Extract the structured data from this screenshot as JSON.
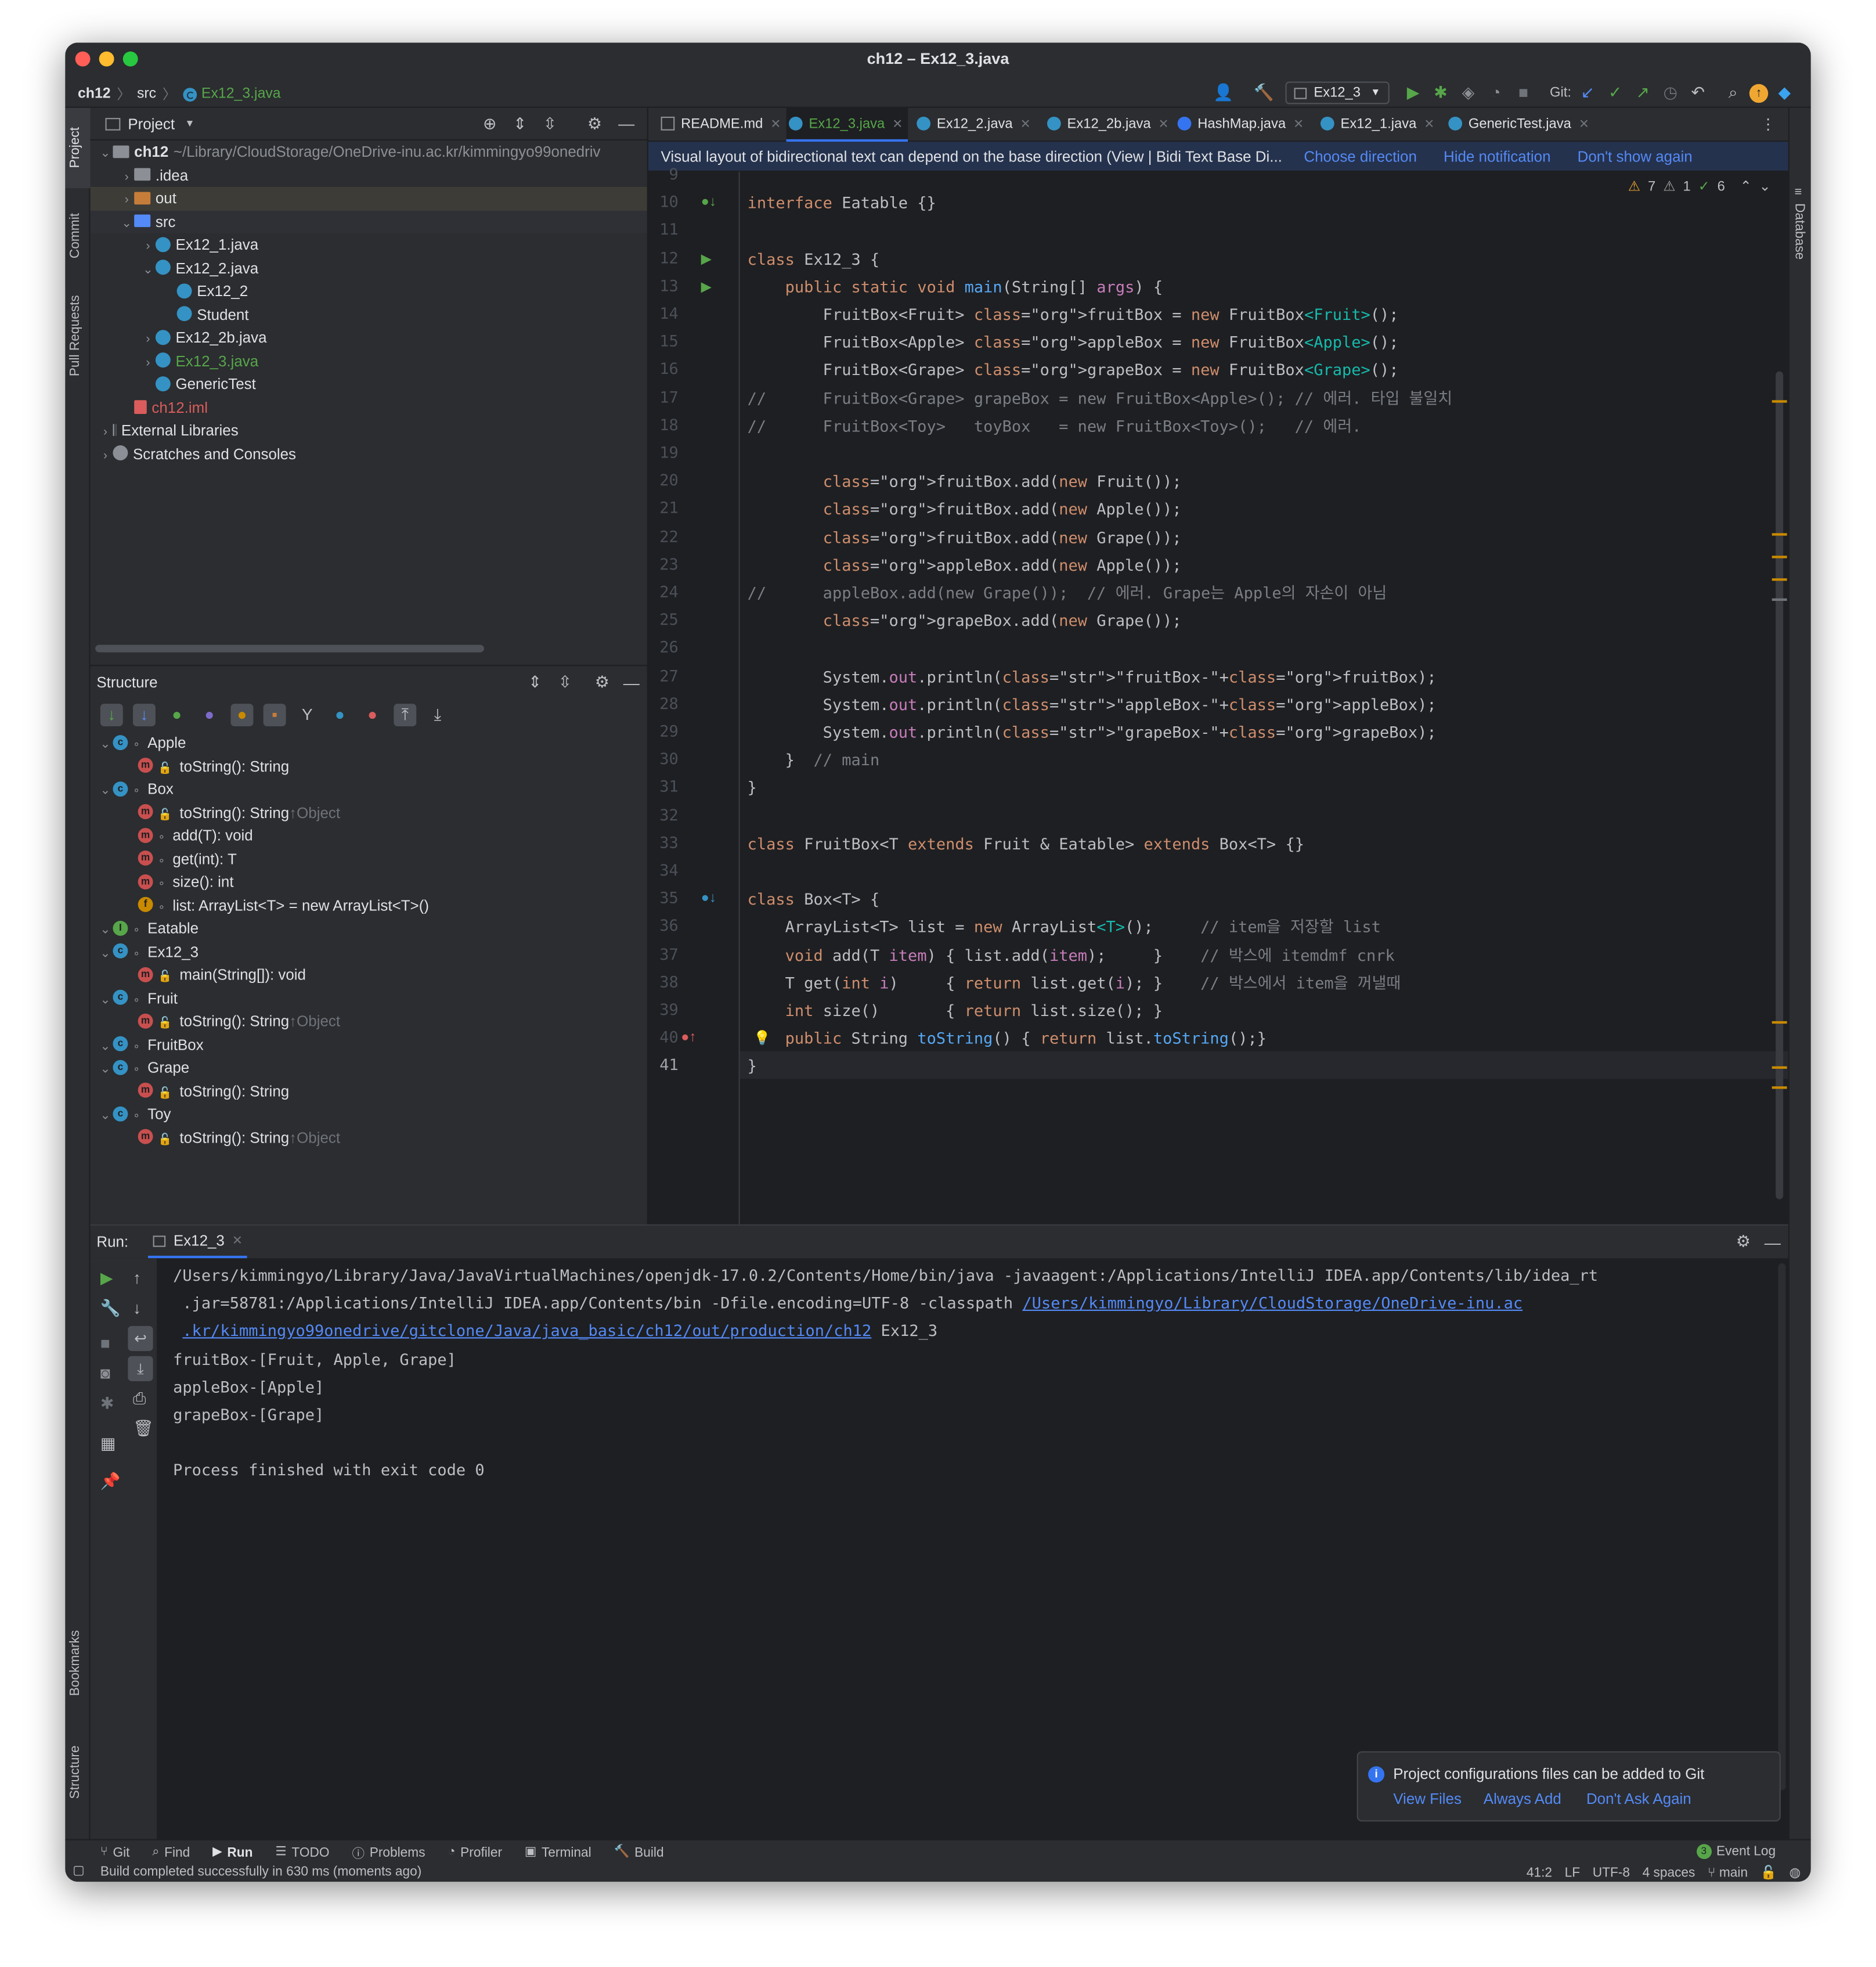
{
  "window": {
    "title": "ch12 – Ex12_3.java"
  },
  "breadcrumb": [
    "ch12",
    "src",
    "Ex12_3.java"
  ],
  "toolbar": {
    "run_config": "Ex12_3",
    "git_label": "Git:"
  },
  "project_panel": {
    "title": "Project",
    "tree": [
      {
        "label": "ch12",
        "extra": "~/Library/CloudStorage/OneDrive-inu.ac.kr/kimmingyo99onedriv",
        "depth": 0,
        "arrow": "v",
        "icon": "folder-icon"
      },
      {
        "label": ".idea",
        "depth": 1,
        "arrow": ">",
        "icon": "folder-icon"
      },
      {
        "label": "out",
        "depth": 1,
        "arrow": ">",
        "icon": "folder-orange-icon"
      },
      {
        "label": "src",
        "depth": 1,
        "arrow": "v",
        "icon": "folder-blue-icon"
      },
      {
        "label": "Ex12_1.java",
        "depth": 2,
        "arrow": ">",
        "icon": "java-class-icon"
      },
      {
        "label": "Ex12_2.java",
        "depth": 2,
        "arrow": "v",
        "icon": "java-class-icon"
      },
      {
        "label": "Ex12_2",
        "depth": 3,
        "arrow": "",
        "icon": "java-class-icon"
      },
      {
        "label": "Student",
        "depth": 3,
        "arrow": "",
        "icon": "java-class-icon"
      },
      {
        "label": "Ex12_2b.java",
        "depth": 2,
        "arrow": ">",
        "icon": "java-class-icon"
      },
      {
        "label": "Ex12_3.java",
        "depth": 2,
        "arrow": ">",
        "icon": "java-class-icon"
      },
      {
        "label": "GenericTest",
        "depth": 2,
        "arrow": "",
        "icon": "java-class-icon"
      },
      {
        "label": "ch12.iml",
        "depth": 1,
        "arrow": "",
        "icon": "iml-icon"
      },
      {
        "label": "External Libraries",
        "depth": 0,
        "arrow": ">",
        "icon": "library-icon"
      },
      {
        "label": "Scratches and Consoles",
        "depth": 0,
        "arrow": ">",
        "icon": "scratch-icon"
      }
    ]
  },
  "structure_panel": {
    "title": "Structure",
    "items": [
      {
        "label": "Apple",
        "sub": "",
        "depth": 0,
        "arrow": "v",
        "icon": "class-icon"
      },
      {
        "label": "toString(): String",
        "sub": "",
        "depth": 1,
        "arrow": "",
        "icon": "method-icon"
      },
      {
        "label": "Box",
        "sub": "",
        "depth": 0,
        "arrow": "v",
        "icon": "class-icon"
      },
      {
        "label": "toString(): String",
        "sub": "↑Object",
        "depth": 1,
        "arrow": "",
        "icon": "method-icon"
      },
      {
        "label": "add(T): void",
        "sub": "",
        "depth": 1,
        "arrow": "",
        "icon": "method-icon"
      },
      {
        "label": "get(int): T",
        "sub": "",
        "depth": 1,
        "arrow": "",
        "icon": "method-icon"
      },
      {
        "label": "size(): int",
        "sub": "",
        "depth": 1,
        "arrow": "",
        "icon": "method-icon"
      },
      {
        "label": "list: ArrayList<T> = new ArrayList<T>()",
        "sub": "",
        "depth": 1,
        "arrow": "",
        "icon": "field-icon"
      },
      {
        "label": "Eatable",
        "sub": "",
        "depth": 0,
        "arrow": "v",
        "icon": "interface-icon"
      },
      {
        "label": "Ex12_3",
        "sub": "",
        "depth": 0,
        "arrow": "v",
        "icon": "class-icon"
      },
      {
        "label": "main(String[]): void",
        "sub": "",
        "depth": 1,
        "arrow": "",
        "icon": "method-icon"
      },
      {
        "label": "Fruit",
        "sub": "",
        "depth": 0,
        "arrow": "v",
        "icon": "class-icon"
      },
      {
        "label": "toString(): String",
        "sub": "↑Object",
        "depth": 1,
        "arrow": "",
        "icon": "method-icon"
      },
      {
        "label": "FruitBox",
        "sub": "",
        "depth": 0,
        "arrow": "v",
        "icon": "class-icon"
      },
      {
        "label": "Grape",
        "sub": "",
        "depth": 0,
        "arrow": "v",
        "icon": "class-icon"
      },
      {
        "label": "toString(): String",
        "sub": "",
        "depth": 1,
        "arrow": "",
        "icon": "method-icon"
      },
      {
        "label": "Toy",
        "sub": "",
        "depth": 0,
        "arrow": "v",
        "icon": "class-icon"
      },
      {
        "label": "toString(): String",
        "sub": "↑Object",
        "depth": 1,
        "arrow": "",
        "icon": "method-icon"
      }
    ]
  },
  "editor": {
    "tabs": [
      {
        "label": "README.md",
        "active": false
      },
      {
        "label": "Ex12_3.java",
        "active": true
      },
      {
        "label": "Ex12_2.java",
        "active": false
      },
      {
        "label": "Ex12_2b.java",
        "active": false
      },
      {
        "label": "HashMap.java",
        "active": false
      },
      {
        "label": "Ex12_1.java",
        "active": false
      },
      {
        "label": "GenericTest.java",
        "active": false
      }
    ],
    "notification": {
      "text": "Visual layout of bidirectional text can depend on the base direction (View | Bidi Text Base Di...",
      "action1": "Choose direction",
      "action2": "Hide notification",
      "action3": "Don't show again"
    },
    "inspection": {
      "warnings": "7",
      "weak": "1",
      "ok": "6"
    },
    "current_line": "41",
    "lines": [
      {
        "n": "9",
        "code": ""
      },
      {
        "n": "10",
        "code": "interface Eatable {}"
      },
      {
        "n": "11",
        "code": ""
      },
      {
        "n": "12",
        "code": "class Ex12_3 {"
      },
      {
        "n": "13",
        "code": "    public static void main(String[] args) {"
      },
      {
        "n": "14",
        "code": "        FruitBox<Fruit> fruitBox = new FruitBox<Fruit>();"
      },
      {
        "n": "15",
        "code": "        FruitBox<Apple> appleBox = new FruitBox<Apple>();"
      },
      {
        "n": "16",
        "code": "        FruitBox<Grape> grapeBox = new FruitBox<Grape>();"
      },
      {
        "n": "17",
        "code": "//      FruitBox<Grape> grapeBox = new FruitBox<Apple>(); // 에러. 타입 불일치"
      },
      {
        "n": "18",
        "code": "//      FruitBox<Toy>   toyBox   = new FruitBox<Toy>();   // 에러."
      },
      {
        "n": "19",
        "code": ""
      },
      {
        "n": "20",
        "code": "        fruitBox.add(new Fruit());"
      },
      {
        "n": "21",
        "code": "        fruitBox.add(new Apple());"
      },
      {
        "n": "22",
        "code": "        fruitBox.add(new Grape());"
      },
      {
        "n": "23",
        "code": "        appleBox.add(new Apple());"
      },
      {
        "n": "24",
        "code": "//      appleBox.add(new Grape());  // 에러. Grape는 Apple의 자손이 아님"
      },
      {
        "n": "25",
        "code": "        grapeBox.add(new Grape());"
      },
      {
        "n": "26",
        "code": ""
      },
      {
        "n": "27",
        "code": "        System.out.println(\"fruitBox-\"+fruitBox);"
      },
      {
        "n": "28",
        "code": "        System.out.println(\"appleBox-\"+appleBox);"
      },
      {
        "n": "29",
        "code": "        System.out.println(\"grapeBox-\"+grapeBox);"
      },
      {
        "n": "30",
        "code": "    }  // main"
      },
      {
        "n": "31",
        "code": "}"
      },
      {
        "n": "32",
        "code": ""
      },
      {
        "n": "33",
        "code": "class FruitBox<T extends Fruit & Eatable> extends Box<T> {}"
      },
      {
        "n": "34",
        "code": ""
      },
      {
        "n": "35",
        "code": "class Box<T> {"
      },
      {
        "n": "36",
        "code": "    ArrayList<T> list = new ArrayList<T>();     // item을 저장할 list"
      },
      {
        "n": "37",
        "code": "    void add(T item) { list.add(item);     }    // 박스에 itemdmf cnrk"
      },
      {
        "n": "38",
        "code": "    T get(int i)     { return list.get(i); }    // 박스에서 item을 꺼낼때"
      },
      {
        "n": "39",
        "code": "    int size()       { return list.size(); }"
      },
      {
        "n": "40",
        "code": "    public String toString() { return list.toString();}"
      },
      {
        "n": "41",
        "code": "}"
      }
    ]
  },
  "run_panel": {
    "label": "Run:",
    "tab": "Ex12_3",
    "console": [
      {
        "text": "/Users/kimmingyo/Library/Java/JavaVirtualMachines/openjdk-17.0.2/Contents/Home/bin/java -javaagent:/Applications/IntelliJ IDEA.app/Contents/lib/idea_rt",
        "link": ""
      },
      {
        "text": " .jar=58781:/Applications/IntelliJ IDEA.app/Contents/bin -Dfile.encoding=UTF-8 -classpath ",
        "link": "/Users/kimmingyo/Library/CloudStorage/OneDrive-inu.ac"
      },
      {
        "text": " ",
        "link": ".kr/kimmingyo99onedrive/gitclone/Java/java_basic/ch12/out/production/ch12",
        "tail": " Ex12_3"
      },
      {
        "text": "fruitBox-[Fruit, Apple, Grape]",
        "link": ""
      },
      {
        "text": "appleBox-[Apple]",
        "link": ""
      },
      {
        "text": "grapeBox-[Grape]",
        "link": ""
      },
      {
        "text": "",
        "link": ""
      },
      {
        "text": "Process finished with exit code 0",
        "link": ""
      }
    ]
  },
  "git_balloon": {
    "text": "Project configurations files can be added to Git",
    "action1": "View Files",
    "action2": "Always Add",
    "action3": "Don't Ask Again"
  },
  "left_stripe": {
    "project": "Project",
    "commit": "Commit",
    "pull_requests": "Pull Requests",
    "bookmarks": "Bookmarks",
    "structure": "Structure"
  },
  "right_stripe": {
    "database": "Database"
  },
  "bottom_tools": [
    {
      "label": "Git",
      "icon": "git-branch-icon"
    },
    {
      "label": "Find",
      "icon": "search-icon"
    },
    {
      "label": "Run",
      "icon": "play-icon"
    },
    {
      "label": "TODO",
      "icon": "list-icon"
    },
    {
      "label": "Problems",
      "icon": "info-icon"
    },
    {
      "label": "Profiler",
      "icon": "profiler-icon"
    },
    {
      "label": "Terminal",
      "icon": "terminal-icon"
    },
    {
      "label": "Build",
      "icon": "hammer-icon"
    }
  ],
  "event_log": {
    "count": "3",
    "label": "Event Log"
  },
  "status_bar": {
    "message": "Build completed successfully in 630 ms (moments ago)",
    "position": "41:2",
    "line_sep": "LF",
    "encoding": "UTF-8",
    "indent": "4 spaces",
    "branch": "main"
  },
  "colors": {
    "accent": "#3574f0",
    "link": "#548af7",
    "keyword": "#cf8e6d",
    "string": "#6aab73",
    "field": "#c77dbb",
    "comment": "#7a7e85",
    "run_green": "#57a64a"
  }
}
